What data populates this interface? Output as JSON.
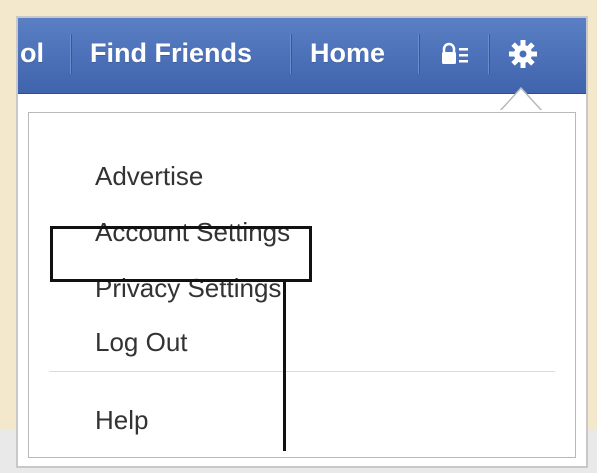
{
  "topbar": {
    "items": [
      {
        "label": "ol"
      },
      {
        "label": "Find Friends"
      },
      {
        "label": "Home"
      }
    ],
    "icons": [
      "lock-list-icon",
      "gear-icon"
    ]
  },
  "account_menu": {
    "items": [
      {
        "label": "Advertise"
      },
      {
        "label": "Account Settings"
      },
      {
        "label": "Privacy Settings",
        "highlighted": true
      },
      {
        "label": "Log Out"
      }
    ],
    "secondary_items": [
      {
        "label": "Help"
      }
    ]
  },
  "colors": {
    "topbar_blue": "#4a6fb8",
    "page_background": "#f3e7cc",
    "menu_text": "#333333",
    "callout": "#111111"
  }
}
